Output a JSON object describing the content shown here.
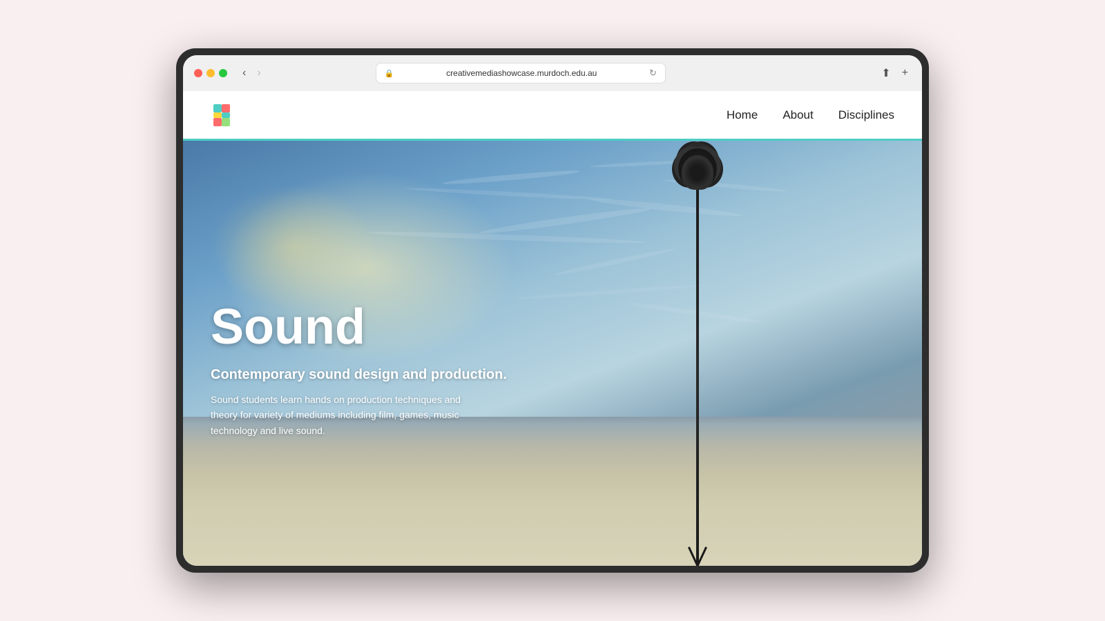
{
  "browser": {
    "url": "creativemediashowcase.murdoch.edu.au",
    "back_disabled": false,
    "forward_disabled": true
  },
  "nav": {
    "logo_alt": "S",
    "menu_items": [
      {
        "label": "Home",
        "href": "#"
      },
      {
        "label": "About",
        "href": "#"
      },
      {
        "label": "Disciplines",
        "href": "#"
      }
    ]
  },
  "hero": {
    "title": "Sound",
    "subtitle": "Contemporary sound design and production.",
    "description": "Sound students learn hands on production techniques and theory for variety of mediums including film, games, music technology and live sound.",
    "bg_alt": "Microphone on stand at beach with dramatic sky"
  },
  "accent_color": "#4ecdc4"
}
